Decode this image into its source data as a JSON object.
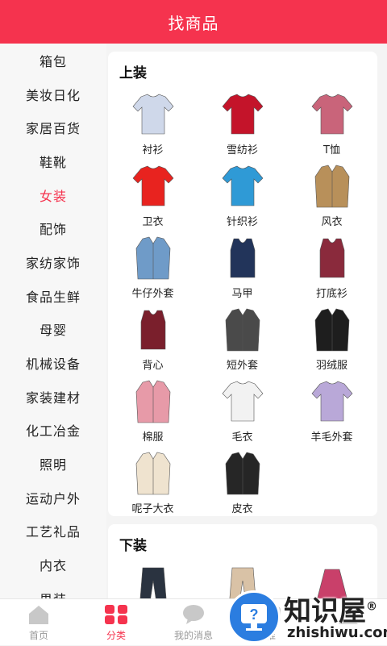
{
  "header": {
    "title": "找商品"
  },
  "sidebar": {
    "items": [
      {
        "label": "箱包"
      },
      {
        "label": "美妆日化"
      },
      {
        "label": "家居百货"
      },
      {
        "label": "鞋靴"
      },
      {
        "label": "女装",
        "active": true
      },
      {
        "label": "配饰"
      },
      {
        "label": "家纺家饰"
      },
      {
        "label": "食品生鲜"
      },
      {
        "label": "母婴"
      },
      {
        "label": "机械设备"
      },
      {
        "label": "家装建材"
      },
      {
        "label": "化工冶金"
      },
      {
        "label": "照明"
      },
      {
        "label": "运动户外"
      },
      {
        "label": "工艺礼品"
      },
      {
        "label": "内衣"
      },
      {
        "label": "男装"
      }
    ]
  },
  "sections": [
    {
      "title": "上装",
      "items": [
        {
          "label": "衬衫",
          "icon": "shirt-icon",
          "color": "#cfd8ea"
        },
        {
          "label": "雪纺衫",
          "icon": "chiffon-shirt-icon",
          "color": "#c4142a"
        },
        {
          "label": "T恤",
          "icon": "tshirt-icon",
          "color": "#c9647a"
        },
        {
          "label": "卫衣",
          "icon": "sweatshirt-icon",
          "color": "#e8231f"
        },
        {
          "label": "针织衫",
          "icon": "cardigan-icon",
          "color": "#2f9ad6"
        },
        {
          "label": "风衣",
          "icon": "trench-coat-icon",
          "color": "#b8905a"
        },
        {
          "label": "牛仔外套",
          "icon": "denim-jacket-icon",
          "color": "#6f9bc8"
        },
        {
          "label": "马甲",
          "icon": "vest-icon",
          "color": "#22345a"
        },
        {
          "label": "打底衫",
          "icon": "camisole-icon",
          "color": "#8a2a3c"
        },
        {
          "label": "背心",
          "icon": "tank-top-icon",
          "color": "#7a1f2c"
        },
        {
          "label": "短外套",
          "icon": "short-jacket-icon",
          "color": "#4a4a4a"
        },
        {
          "label": "羽绒服",
          "icon": "down-jacket-icon",
          "color": "#1e1e1e"
        },
        {
          "label": "棉服",
          "icon": "padded-coat-icon",
          "color": "#e79aa8"
        },
        {
          "label": "毛衣",
          "icon": "sweater-icon",
          "color": "#f2f2f2"
        },
        {
          "label": "羊毛外套",
          "icon": "wool-jacket-icon",
          "color": "#b9a8d8"
        },
        {
          "label": "呢子大衣",
          "icon": "wool-coat-icon",
          "color": "#efe3cf"
        },
        {
          "label": "皮衣",
          "icon": "leather-jacket-icon",
          "color": "#262626"
        }
      ]
    },
    {
      "title": "下装",
      "items": [
        {
          "icon": "pants-icon",
          "color": "#2a3340"
        },
        {
          "icon": "wide-pants-icon",
          "color": "#d9c2a6"
        },
        {
          "icon": "skirt-icon",
          "color": "#c9406a"
        }
      ]
    }
  ],
  "tabbar": {
    "tabs": [
      {
        "label": "首页",
        "icon": "home-icon"
      },
      {
        "label": "分类",
        "icon": "category-icon",
        "active": true
      },
      {
        "label": "我的消息",
        "icon": "message-icon"
      },
      {
        "label": "推",
        "icon": "recommend-icon"
      },
      {
        "label": "",
        "icon": "profile-icon"
      }
    ]
  },
  "watermark": {
    "big": "知识屋",
    "small": "zhishiwu.com",
    "reg": "®"
  }
}
